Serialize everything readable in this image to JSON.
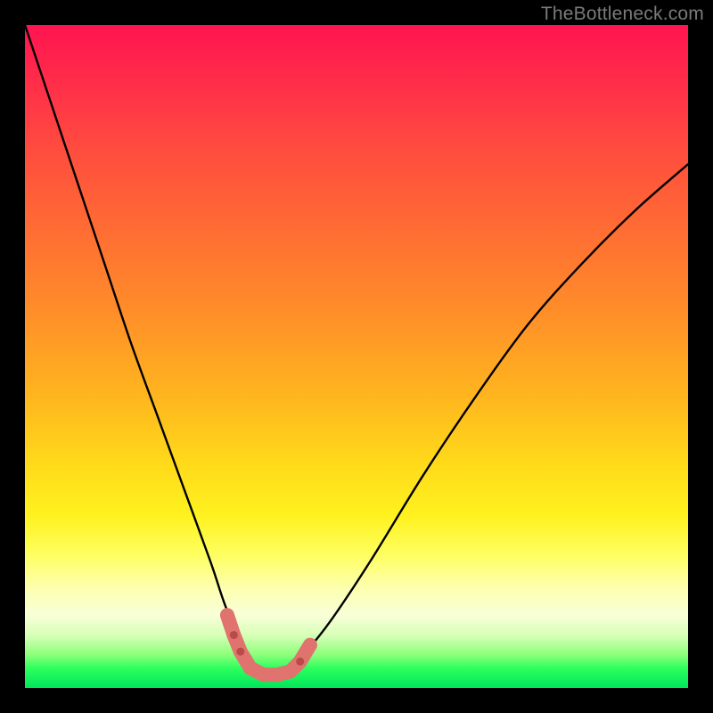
{
  "watermark": "TheBottleneck.com",
  "colors": {
    "frame": "#000000",
    "curve_stroke": "#000000",
    "marker_fill": "#e0736e",
    "marker_stroke": "#b84a49"
  },
  "chart_data": {
    "type": "line",
    "title": "",
    "xlabel": "",
    "ylabel": "",
    "xlim": [
      0,
      100
    ],
    "ylim": [
      0,
      100
    ],
    "grid": false,
    "legend": null,
    "note": "Axes are unlabeled; x/y read as 0–100 percent of plot width/height. y=0 is the bottom (green) edge. Curve depicts a bottleneck-style V with minimum near x≈36.",
    "series": [
      {
        "name": "bottleneck-curve",
        "x": [
          0,
          4,
          8,
          12,
          16,
          20,
          24,
          28,
          30,
          32,
          34,
          36,
          38,
          40,
          42,
          46,
          52,
          60,
          68,
          76,
          84,
          92,
          100
        ],
        "y": [
          100,
          88,
          76,
          64,
          52,
          41,
          30,
          19,
          13,
          8,
          4,
          2,
          2,
          3,
          5,
          10,
          19,
          32,
          44,
          55,
          64,
          72,
          79
        ]
      }
    ],
    "markers": {
      "name": "highlight-band",
      "note": "Salmon rounded segments near the trough of the curve, roughly x≈30–43, y≈2–11.",
      "points": [
        {
          "x": 30.5,
          "y": 11
        },
        {
          "x": 31.5,
          "y": 8
        },
        {
          "x": 32.5,
          "y": 5.5
        },
        {
          "x": 34.0,
          "y": 3.0
        },
        {
          "x": 36.0,
          "y": 2.0
        },
        {
          "x": 38.0,
          "y": 2.0
        },
        {
          "x": 40.0,
          "y": 2.5
        },
        {
          "x": 41.5,
          "y": 4.0
        },
        {
          "x": 43.0,
          "y": 6.5
        }
      ]
    }
  }
}
